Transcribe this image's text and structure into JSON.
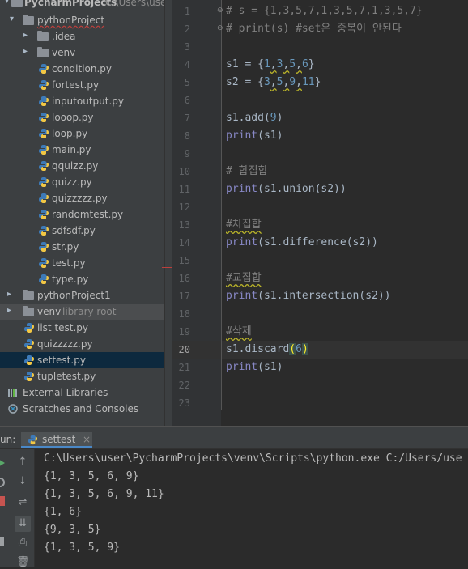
{
  "project_tree": {
    "root_label": "PycharmProjects",
    "root_path": "C:\\Users\\user",
    "items": [
      {
        "label": "pythonProject"
      },
      {
        "label": ".idea"
      },
      {
        "label": "venv"
      },
      {
        "label": "condition.py"
      },
      {
        "label": "fortest.py"
      },
      {
        "label": "inputoutput.py"
      },
      {
        "label": "looop.py"
      },
      {
        "label": "loop.py"
      },
      {
        "label": "main.py"
      },
      {
        "label": "qquizz.py"
      },
      {
        "label": "quizz.py"
      },
      {
        "label": "quizzzzz.py"
      },
      {
        "label": "randomtest.py"
      },
      {
        "label": "sdfsdf.py"
      },
      {
        "label": "str.py"
      },
      {
        "label": "test.py"
      },
      {
        "label": "type.py"
      },
      {
        "label": "pythonProject1"
      },
      {
        "label": "venv",
        "suffix": "library root"
      },
      {
        "label": "list test.py"
      },
      {
        "label": "quizzzzz.py"
      },
      {
        "label": "settest.py"
      },
      {
        "label": "tupletest.py"
      },
      {
        "label": "External Libraries"
      },
      {
        "label": "Scratches and Consoles"
      }
    ]
  },
  "editor": {
    "line_numbers": [
      "1",
      "2",
      "3",
      "4",
      "5",
      "6",
      "7",
      "8",
      "9",
      "10",
      "11",
      "12",
      "13",
      "14",
      "15",
      "16",
      "17",
      "18",
      "19",
      "20",
      "21",
      "22",
      "23"
    ],
    "current_line": "20",
    "lines": {
      "l1": "# s = {1,3,5,7,1,3,5,7,1,3,5,7}",
      "l2": "# print(s) #set은 중복이 안된다",
      "l4a": "s1 = {",
      "l4b": "1",
      "l4c": ",",
      "l4d": "3",
      "l4e": ",",
      "l4f": "5",
      "l4g": ",",
      "l4h": "6",
      "l4i": "}",
      "l5a": "s2 = {",
      "l5b": "3",
      "l5c": ",",
      "l5d": "5",
      "l5e": ",",
      "l5f": "9",
      "l5g": ",",
      "l5h": "11",
      "l5i": "}",
      "l7a": "s1.add(",
      "l7b": "9",
      "l7c": ")",
      "l8a": "print",
      "l8b": "(s1)",
      "l10": "# 합집합",
      "l11a": "print",
      "l11b": "(s1.union(s2))",
      "l13": "#차집합",
      "l14a": "print",
      "l14b": "(s1.difference(s2))",
      "l16": "#교집합",
      "l17a": "print",
      "l17b": "(s1.intersection(s2))",
      "l19": "#삭제",
      "l20a": "s1.discard",
      "l20b": "(",
      "l20c": "6",
      "l20d": ")",
      "l21a": "print",
      "l21b": "(s1)"
    }
  },
  "run_panel": {
    "label": "un:",
    "tab_label": "settest",
    "tab_close": "×",
    "command": "C:\\Users\\user\\PycharmProjects\\venv\\Scripts\\python.exe C:/Users/use",
    "output": [
      "{1, 3, 5, 6, 9}",
      "{1, 3, 5, 6, 9, 11}",
      "{1, 6}",
      "{9, 3, 5}",
      "{1, 3, 5, 9}"
    ]
  },
  "colors": {
    "comment": "#808080",
    "builtin": "#8888c6",
    "number": "#6897bb",
    "selection": "#0d293e",
    "python_blue": "#3d7ab8",
    "python_yellow": "#f2c744"
  }
}
